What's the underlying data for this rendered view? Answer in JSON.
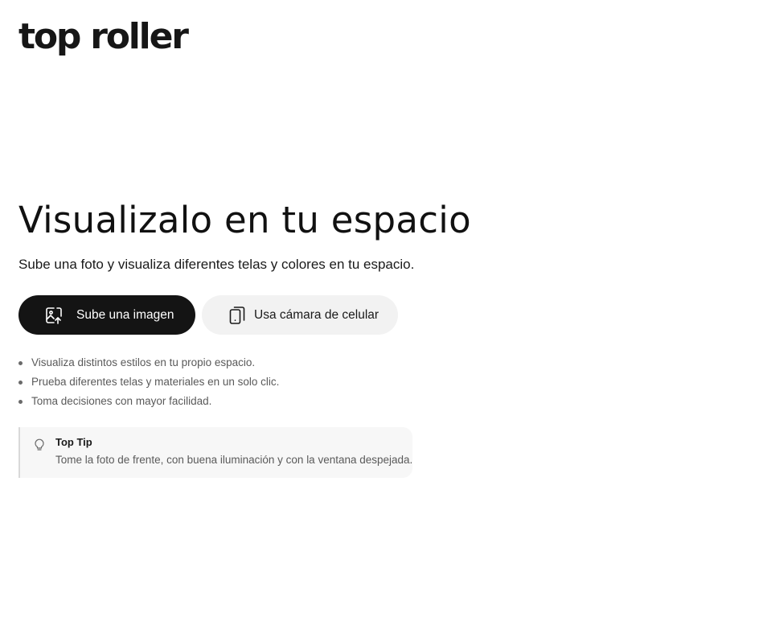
{
  "brand": {
    "logo_text": "top roller"
  },
  "hero": {
    "title": "Visualizalo en tu espacio",
    "subtitle": "Sube una foto y visualiza diferentes telas y colores en tu espacio."
  },
  "actions": {
    "upload": {
      "label": "Sube una imagen",
      "icon": "image-upload-icon"
    },
    "camera": {
      "label": "Usa cámara de celular",
      "icon": "phone-camera-icon"
    }
  },
  "features": [
    "Visualiza distintos estilos en tu propio espacio.",
    "Prueba diferentes telas y materiales en un solo clic.",
    "Toma decisiones con mayor facilidad."
  ],
  "tip": {
    "icon": "lightbulb-icon",
    "title": "Top Tip",
    "text": "Tome la foto de frente, con buena iluminación y con la ventana despejada."
  },
  "colors": {
    "primary_button": "#141414",
    "secondary_button": "#f2f2f2",
    "tip_background": "#f7f7f7",
    "text": "#141414",
    "muted_text": "#5a5a5a"
  }
}
